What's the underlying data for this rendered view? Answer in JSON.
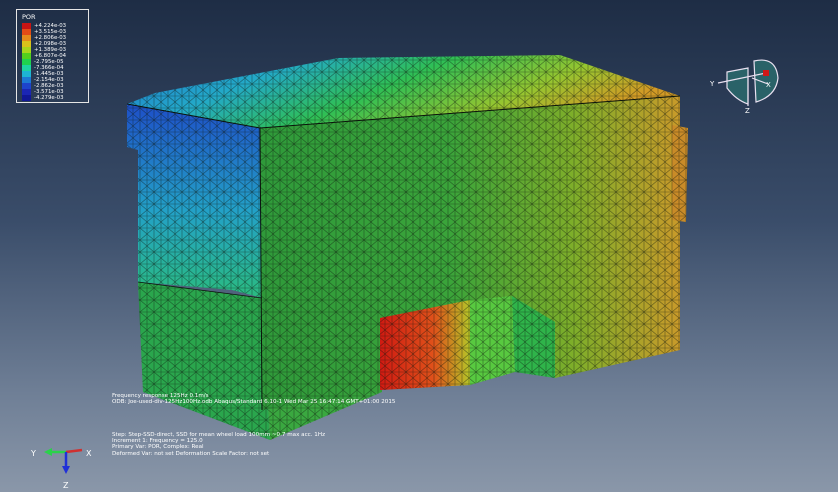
{
  "legend": {
    "title": "POR",
    "entries": [
      {
        "label": "+4.224e-03",
        "color": "#c81414"
      },
      {
        "label": "+3.515e-03",
        "color": "#e34b16"
      },
      {
        "label": "+2.806e-03",
        "color": "#e58a1b"
      },
      {
        "label": "+2.098e-03",
        "color": "#d9c21c"
      },
      {
        "label": "+1.389e-03",
        "color": "#a7d51c"
      },
      {
        "label": "+6.807e-04",
        "color": "#52cf1d"
      },
      {
        "label": "-2.795e-05",
        "color": "#1fd14d"
      },
      {
        "label": "-7.366e-04",
        "color": "#1dd3a0"
      },
      {
        "label": "-1.445e-03",
        "color": "#1db4d4"
      },
      {
        "label": "-2.154e-03",
        "color": "#1d79d4"
      },
      {
        "label": "-2.862e-03",
        "color": "#1d44cc"
      },
      {
        "label": "-3.571e-03",
        "color": "#1b26b4"
      },
      {
        "label": "-4.279e-03",
        "color": "#111896"
      }
    ]
  },
  "info_upper": [
    "Frequency response 125Hz 0.1m/s",
    "ODB: Joe-used-div-125Hz100Hz.odb    Abaqus/Standard 6.10-1    Wed Mar 25 16:47:14 GMT+01:00 2015"
  ],
  "info_lower": [
    "Step: Step-SSD-direct, SSD for mean wheel load 100mm ~0.7 max acc. 1Hz",
    "Increment      1: Frequency =    125.0",
    "Primary Var: POR,  Complex: Real",
    "Deformed Var: not set   Deformation Scale Factor: not set"
  ],
  "triad": {
    "y_label": "Y",
    "x_label": "X",
    "z_label": "Z"
  },
  "view_cube": {
    "y_label": "Y",
    "x_label": "X",
    "z_label": "Z"
  }
}
